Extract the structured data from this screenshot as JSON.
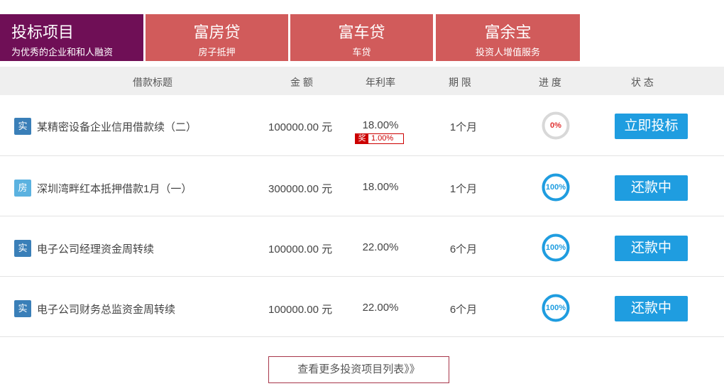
{
  "tabs": [
    {
      "title": "投标项目",
      "subtitle": "为优秀的企业和和人融资",
      "active": true
    },
    {
      "title": "富房贷",
      "subtitle": "房子抵押",
      "active": false
    },
    {
      "title": "富车贷",
      "subtitle": "车贷",
      "active": false
    },
    {
      "title": "富余宝",
      "subtitle": "投资人增值服务",
      "active": false
    }
  ],
  "columns": {
    "title": "借款标题",
    "amount": "金 额",
    "rate": "年利率",
    "term": "期 限",
    "progress": "进 度",
    "status": "状 态"
  },
  "rows": [
    {
      "type": "实",
      "type_color": "#3a7fb8",
      "title": "某精密设备企业信用借款续（二）",
      "amount": "100000.00 元",
      "rate": "18.00%",
      "bonus_tag": "奖",
      "bonus_value": "1.00%",
      "term": "1个月",
      "progress_label": "0%",
      "progress_value": 0,
      "action": "立即投标"
    },
    {
      "type": "房",
      "type_color": "#5bb2e0",
      "title": "深圳湾畔红本抵押借款1月（一）",
      "amount": "300000.00 元",
      "rate": "18.00%",
      "term": "1个月",
      "progress_label": "100%",
      "progress_value": 100,
      "action": "还款中"
    },
    {
      "type": "实",
      "type_color": "#3a7fb8",
      "title": "电子公司经理资金周转续",
      "amount": "100000.00 元",
      "rate": "22.00%",
      "term": "6个月",
      "progress_label": "100%",
      "progress_value": 100,
      "action": "还款中"
    },
    {
      "type": "实",
      "type_color": "#3a7fb8",
      "title": "电子公司财务总监资金周转续",
      "amount": "100000.00 元",
      "rate": "22.00%",
      "term": "6个月",
      "progress_label": "100%",
      "progress_value": 100,
      "action": "还款中"
    }
  ],
  "more_link": "查看更多投资项目列表》》",
  "colors": {
    "active_tab": "#6f0f56",
    "tab": "#d15b5b",
    "button": "#1f9de0",
    "progress_full": "#1f9de0",
    "progress_zero_text": "#e03030",
    "bonus": "#cc0000"
  }
}
